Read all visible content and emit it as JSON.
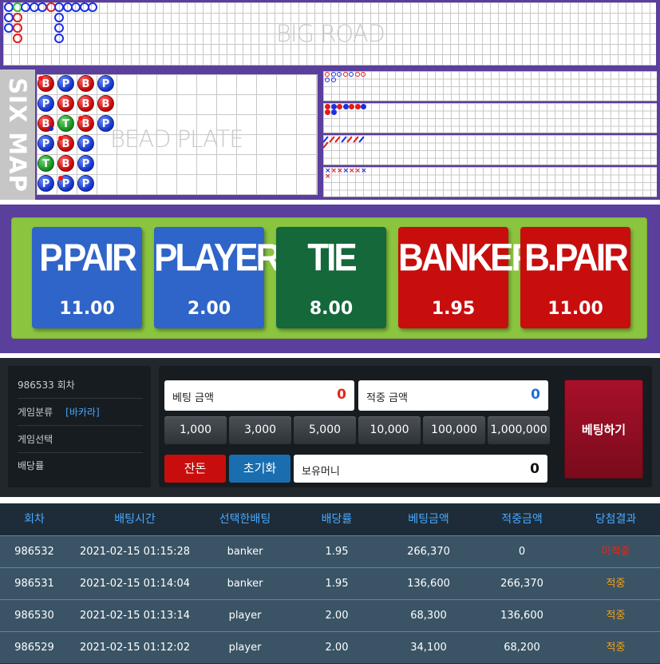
{
  "big_road": {
    "watermark": "BIG ROAD",
    "columns": [
      [
        "P",
        "P",
        "P"
      ],
      [
        "T",
        "B",
        "B",
        "B"
      ],
      [
        "P"
      ],
      [
        "P"
      ],
      [
        "P"
      ],
      [
        "B"
      ],
      [
        "P",
        "P",
        "P",
        "P"
      ],
      [
        "P"
      ],
      [
        "P"
      ],
      [
        "P"
      ],
      [
        "P"
      ]
    ]
  },
  "six_map": {
    "label": "SIX MAP",
    "bead_plate": {
      "watermark": "BEAD PLATE",
      "columns": [
        [
          {
            "r": "B",
            "pair": "red"
          },
          {
            "r": "P"
          },
          {
            "r": "B",
            "pair": "blue"
          },
          {
            "r": "P"
          },
          {
            "r": "T"
          },
          {
            "r": "P"
          }
        ],
        [
          {
            "r": "P"
          },
          {
            "r": "B"
          },
          {
            "r": "T"
          },
          {
            "r": "B",
            "pair": "red"
          },
          {
            "r": "B"
          },
          {
            "r": "P",
            "pair": "red"
          }
        ],
        [
          {
            "r": "B"
          },
          {
            "r": "B"
          },
          {
            "r": "B",
            "pair": "red"
          },
          {
            "r": "P"
          },
          {
            "r": "P"
          },
          {
            "r": "P"
          }
        ],
        [
          {
            "r": "P"
          },
          {
            "r": "B"
          },
          {
            "r": "P"
          }
        ]
      ]
    },
    "big_eye_road": [
      "b",
      "p",
      "p",
      "b",
      "p",
      "b",
      "b",
      "p",
      "p"
    ],
    "small_road": [
      "b",
      "p",
      "b",
      "p",
      "b",
      "b",
      "p",
      "b",
      "p"
    ],
    "cockroach_road": [
      "p",
      "b",
      "b",
      "p",
      "b",
      "b",
      "p",
      "b"
    ],
    "fourth_road": [
      "p",
      "b",
      "b",
      "p",
      "b",
      "b",
      "p",
      "b"
    ]
  },
  "bets": [
    {
      "name": "P.PAIR",
      "odds": "11.00",
      "color": "#2f64c8"
    },
    {
      "name": "PLAYER",
      "odds": "2.00",
      "color": "#2f64c8"
    },
    {
      "name": "TIE",
      "odds": "8.00",
      "color": "#14683a"
    },
    {
      "name": "BANKER",
      "odds": "1.95",
      "color": "#c80d0d"
    },
    {
      "name": "B.PAIR",
      "odds": "11.00",
      "color": "#c80d0d"
    }
  ],
  "info": {
    "round": "986533 회차",
    "game_type_label": "게임분류",
    "game_type_value": "[바카라]",
    "game_select_label": "게임선택",
    "payout_label": "배당률"
  },
  "bet_panel": {
    "bet_amount_label": "베팅 금액",
    "bet_amount_value": "0",
    "win_amount_label": "적중 금액",
    "win_amount_value": "0",
    "chips": [
      "1,000",
      "3,000",
      "5,000",
      "10,000",
      "100,000",
      "1,000,000"
    ],
    "remaining_label": "잔돈",
    "reset_label": "초기화",
    "balance_label": "보유머니",
    "balance_value": "0",
    "submit_label": "베팅하기"
  },
  "history": {
    "headers": [
      "회차",
      "배팅시간",
      "선택한배팅",
      "배당률",
      "베팅금액",
      "적중금액",
      "당첨결과"
    ],
    "rows": [
      [
        "986532",
        "2021-02-15 01:15:28",
        "banker",
        "1.95",
        "266,370",
        "0",
        "미적중"
      ],
      [
        "986531",
        "2021-02-15 01:14:04",
        "banker",
        "1.95",
        "136,600",
        "266,370",
        "적중"
      ],
      [
        "986530",
        "2021-02-15 01:13:14",
        "player",
        "2.00",
        "68,300",
        "136,600",
        "적중"
      ],
      [
        "986529",
        "2021-02-15 01:12:02",
        "player",
        "2.00",
        "34,100",
        "68,200",
        "적중"
      ]
    ]
  },
  "colors": {
    "frame": "#5a3f9d",
    "bet_area": "#8bc53f",
    "history_accent": "#4aa8ff",
    "miss": "#e0281a",
    "hit": "#f1a11b"
  }
}
